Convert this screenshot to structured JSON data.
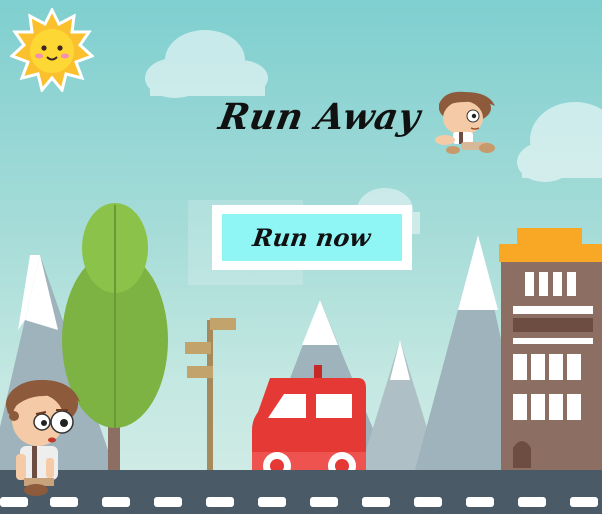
{
  "game": {
    "title": "Run Away",
    "start_button_label": "Run now"
  },
  "palette": {
    "sky": "#7fcfd0",
    "button_fill": "#8ff5f5",
    "button_border": "#ffffff",
    "road": "#4a5a66",
    "car": "#e53935",
    "building": "#8d6e63",
    "building_roof": "#f9a825",
    "tree": "#7cb342"
  },
  "sprites": [
    "sun-icon",
    "player-character",
    "player-character-small",
    "tree",
    "signpost",
    "red-car",
    "building",
    "mountains",
    "clouds",
    "road"
  ]
}
